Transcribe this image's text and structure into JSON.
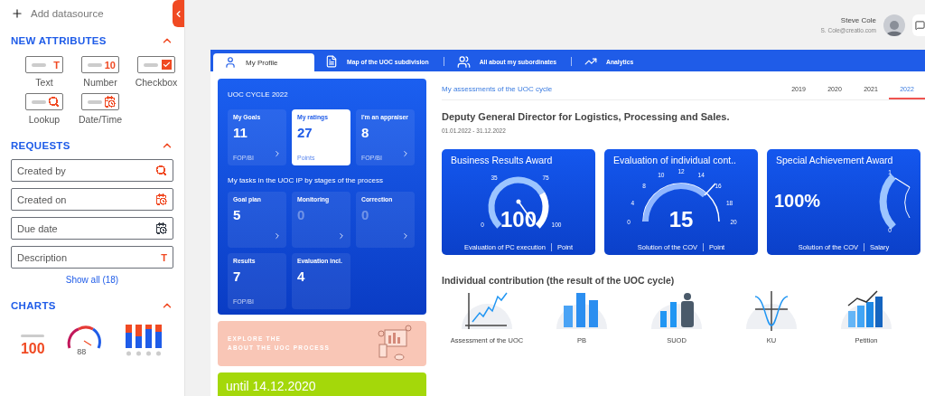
{
  "sidebar": {
    "add_button": "Add datasource",
    "sections": [
      {
        "kind": "attributes",
        "title": "NEW ATTRIBUTES",
        "expanded": true,
        "items": [
          {
            "kind": "text",
            "glyph": "T",
            "label": "Text"
          },
          {
            "kind": "number",
            "glyph": "10",
            "label": "Number"
          },
          {
            "kind": "checkbox",
            "label": "Checkbox"
          },
          {
            "kind": "lookup",
            "label": "Lookup"
          },
          {
            "kind": "datetime",
            "label": "Date/Time"
          }
        ]
      },
      {
        "kind": "requests",
        "title": "REQUESTS",
        "expanded": true,
        "items": [
          {
            "kind": "lookup",
            "label": "Created by",
            "color": "#f04a23"
          },
          {
            "kind": "datetime",
            "label": "Created on",
            "color": "#f04a23"
          },
          {
            "kind": "datetime",
            "label": "Due date",
            "color": "#333a44"
          },
          {
            "kind": "text",
            "glyph": "T",
            "label": "Description",
            "color": "#f04a23"
          }
        ],
        "show_all": "Show all (18)"
      },
      {
        "kind": "charts",
        "title": "CHARTS",
        "expanded": true,
        "items": [
          {
            "kind": "metric",
            "value": "100"
          },
          {
            "kind": "gauge",
            "value": "88"
          },
          {
            "kind": "bars"
          }
        ]
      }
    ]
  },
  "header": {
    "user_name": "Steve Cole",
    "user_email": "S. Cole@creatio.com"
  },
  "tabs": [
    {
      "kind": "profile",
      "label": "My Profile",
      "selected": true
    },
    {
      "kind": "map",
      "label": "Map of the UOC subdivision",
      "selected": false
    },
    {
      "kind": "people",
      "label": "All about my subordinates",
      "selected": false
    },
    {
      "kind": "analytics",
      "label": "Analytics",
      "selected": false
    }
  ],
  "cycle_panel": {
    "title": "UOC CYCLE 2022",
    "stats": [
      {
        "label": "My Goals",
        "value": "11",
        "unit": "FOP/BI",
        "selected": false
      },
      {
        "label": "My ratings",
        "value": "27",
        "unit": "Points",
        "selected": true
      },
      {
        "label": "I'm an appraiser",
        "value": "8",
        "unit": "FOP/BI",
        "selected": false
      }
    ],
    "tasks_title": "My tasks in the UOC IP by stages of the process",
    "tasks": [
      {
        "label": "Goal plan",
        "value": "5",
        "muted": false,
        "arrow": true
      },
      {
        "label": "Monitoring",
        "value": "0",
        "muted": true,
        "arrow": true
      },
      {
        "label": "Correction",
        "value": "0",
        "muted": true,
        "arrow": true
      },
      {
        "label": "Results",
        "value": "7",
        "unit": "FOP/BI",
        "muted": false,
        "arrow": false
      },
      {
        "label": "Evaluation incl.",
        "value": "4",
        "muted": false,
        "arrow": false
      }
    ]
  },
  "explore_banner": {
    "lines": [
      "EXPLORE THE",
      "ABOUT THE UOC PROCESS"
    ]
  },
  "deadline_banner": {
    "text": "until 14.12.2020"
  },
  "assessments": {
    "title": "My assessments of the UOC cycle",
    "years": [
      {
        "label": "2019",
        "selected": false
      },
      {
        "label": "2020",
        "selected": false
      },
      {
        "label": "2021",
        "selected": false
      },
      {
        "label": "2022",
        "selected": true
      }
    ],
    "position": "Deputy General Director for Logistics, Processing and Sales.",
    "period": "01.01.2022 - 31.12.2022",
    "gauges": [
      {
        "kind": "dial",
        "title": "Business Results Award",
        "ticks": [
          "0",
          "35",
          "75",
          "100"
        ],
        "value": "100",
        "footer": [
          "Evaluation of PC execution",
          "Point"
        ]
      },
      {
        "kind": "semicircle",
        "title": "Evaluation of individual cont..",
        "ticks": [
          "0",
          "4",
          "8",
          "10",
          "12",
          "14",
          "16",
          "18",
          "20"
        ],
        "value": "15",
        "footer": [
          "Solution of the COV",
          "Point"
        ]
      },
      {
        "kind": "side",
        "title": "Special Achievement Award",
        "ticks": [
          "1",
          "0"
        ],
        "value": "100%",
        "footer": [
          "Solution of the COV",
          "Salary"
        ]
      }
    ]
  },
  "contribution": {
    "title": "Individual contribution (the result of the UOC cycle)",
    "items": [
      {
        "kind": "line",
        "label": "Assessment of the UOC"
      },
      {
        "kind": "columns",
        "label": "PB"
      },
      {
        "kind": "person",
        "label": "SUOD"
      },
      {
        "kind": "curve",
        "label": "KU"
      },
      {
        "kind": "growth",
        "label": "Petition"
      }
    ]
  }
}
